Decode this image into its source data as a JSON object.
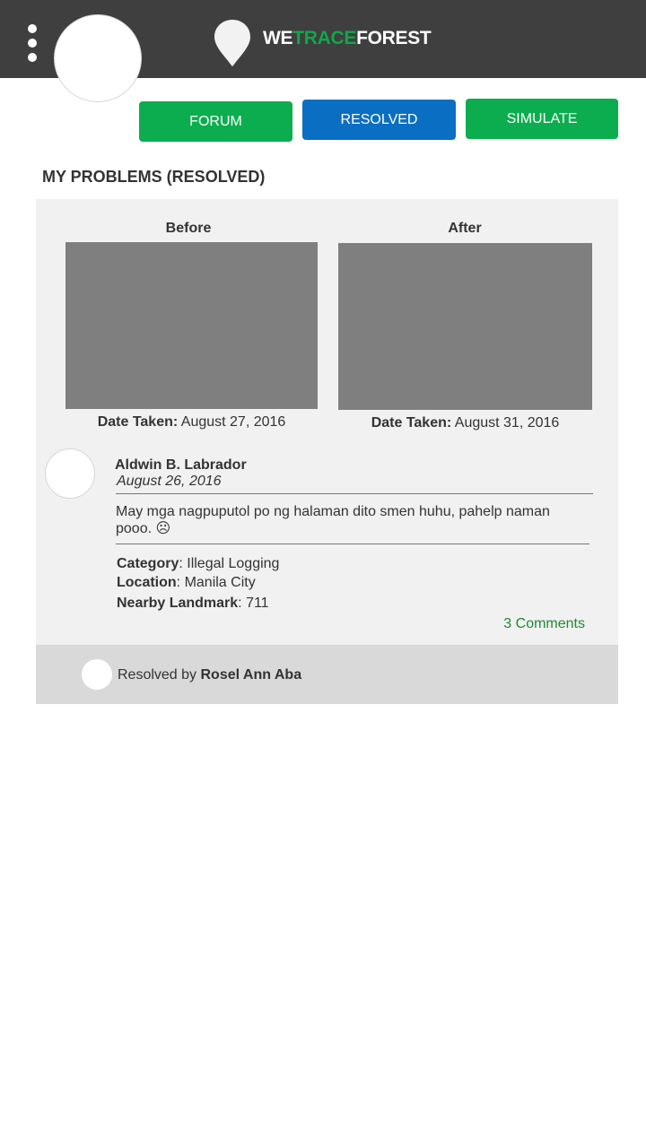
{
  "app": {
    "brand_part1": "WE",
    "brand_part2": "TRACE",
    "brand_part3": "FOREST",
    "colors": {
      "topbar": "#3f3f3f",
      "brand_green": "#12a64b",
      "tab_green": "#0cad4f",
      "tab_blue": "#0a6fc2",
      "link_green": "#1c8a2e"
    }
  },
  "tabs": {
    "forum": "FORUM",
    "resolved": "RESOLVED",
    "simulate": "SIMULATE",
    "active": "resolved"
  },
  "section_title": "MY PROBLEMS (RESOLVED)",
  "problem": {
    "before_label": "Before",
    "after_label": "After",
    "date_taken_label": "Date Taken:",
    "before_date": "August 27, 2016",
    "after_date": "August 31, 2016",
    "author": "Aldwin B. Labrador",
    "posted_date": "August 26, 2016",
    "text": "May mga nagpuputol po ng halaman dito smen huhu, pahelp naman pooo. ☹",
    "category_label": "Category",
    "category": "Illegal Logging",
    "location_label": "Location",
    "location": "Manila City",
    "landmark_label": "Nearby Landmark",
    "landmark": "711",
    "comments": "3 Comments",
    "resolved_prefix": "Resolved by",
    "resolved_by": "Rosel Ann Aba"
  }
}
